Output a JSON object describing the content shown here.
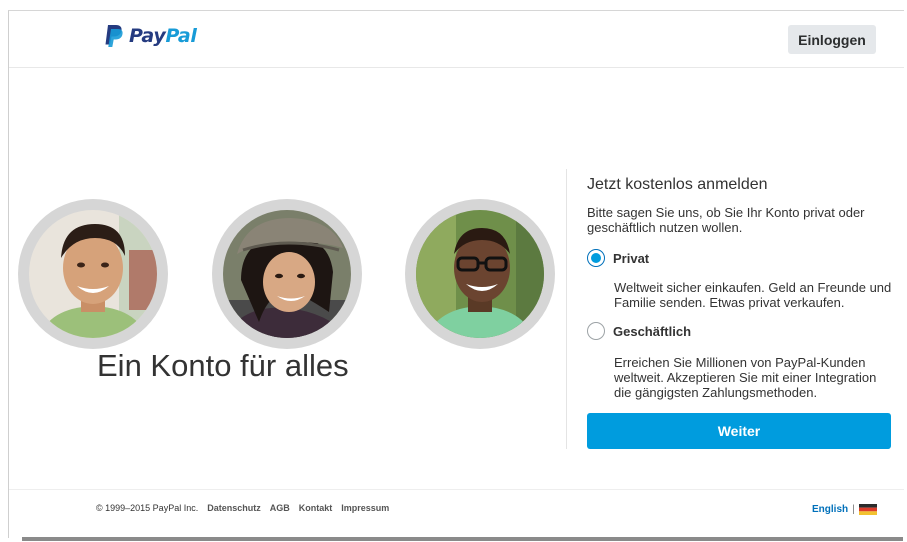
{
  "header": {
    "logo_pay": "Pay",
    "logo_pal": "Pal",
    "login_label": "Einloggen"
  },
  "hero": {
    "headline": "Ein Konto für alles"
  },
  "signup": {
    "title": "Jetzt kostenlos anmelden",
    "intro": "Bitte sagen Sie uns, ob Sie Ihr Konto privat oder geschäftlich nutzen wollen.",
    "options": [
      {
        "label": "Privat",
        "selected": true,
        "description": "Weltweit sicher einkaufen. Geld an Freunde und Familie senden. Etwas privat verkaufen."
      },
      {
        "label": "Geschäftlich",
        "selected": false,
        "description": "Erreichen Sie Millionen von PayPal-Kunden weltweit. Akzeptieren Sie mit einer Integration die gängigsten Zahlungsmethoden."
      }
    ],
    "continue_label": "Weiter"
  },
  "footer": {
    "copyright": "© 1999–2015 PayPal Inc.",
    "links": [
      "Datenschutz",
      "AGB",
      "Kontakt",
      "Impressum"
    ],
    "language": "English",
    "separator": "|",
    "flag_icon": "germany-flag-icon"
  },
  "colors": {
    "brand_dark": "#253b80",
    "brand_light": "#179bd7",
    "button_blue": "#009cde",
    "link_blue": "#0070ba"
  }
}
